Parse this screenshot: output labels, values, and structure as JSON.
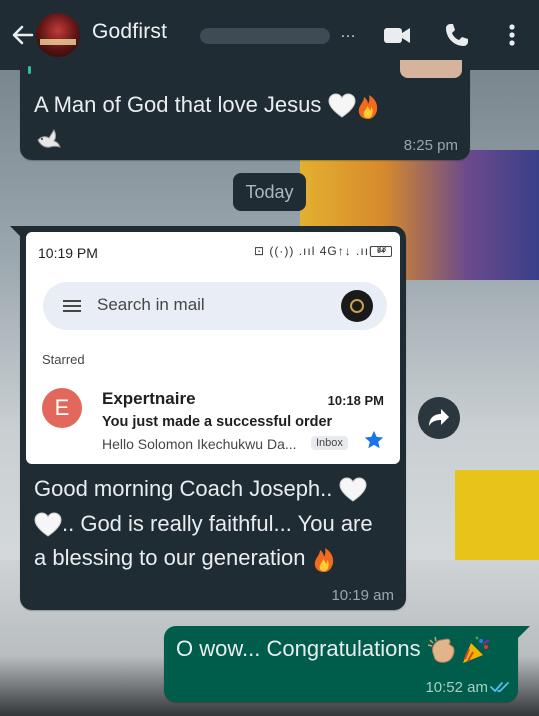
{
  "header": {
    "contact_name": "Godfirst",
    "title_overflow": "…"
  },
  "messages": [
    {
      "direction": "incoming",
      "text": "A Man of God that love Jesus",
      "emojis": [
        "white-heart",
        "fire",
        "dove"
      ],
      "time": "8:25 pm"
    },
    {
      "direction": "incoming",
      "forwarded_screenshot": {
        "status_time": "10:19 PM",
        "status_icons": "⊡ ((·)) .ııl 4G↑↓ .ııl ²³",
        "battery": "94",
        "search_placeholder": "Search in mail",
        "section_label": "Starred",
        "mail": {
          "avatar_letter": "E",
          "sender": "Expertnaire",
          "time": "10:18 PM",
          "subject": "You just made a successful order",
          "preview": "Hello Solomon Ikechukwu Da...",
          "label": "Inbox",
          "starred": true
        }
      },
      "text_line1": "Good morning Coach Joseph..",
      "text_line2": ".. God is really faithful... You are",
      "text_line3": "a blessing to our generation",
      "time": "10:19 am"
    },
    {
      "direction": "outgoing",
      "text": "O wow... Congratulations",
      "time": "10:52 am",
      "status": "read"
    }
  ],
  "date_separator": "Today",
  "colors": {
    "header_bg": "#1f2c34",
    "incoming_bubble": "#1f2c34",
    "outgoing_bubble": "#005c4b",
    "read_ticks": "#53bdeb",
    "mail_avatar": "#e1685a",
    "star": "#1a73e8"
  },
  "icons": [
    "back-arrow-icon",
    "video-call-icon",
    "phone-icon",
    "more-vert-icon",
    "forward-icon",
    "menu-icon",
    "star-icon",
    "read-receipt-icon"
  ]
}
